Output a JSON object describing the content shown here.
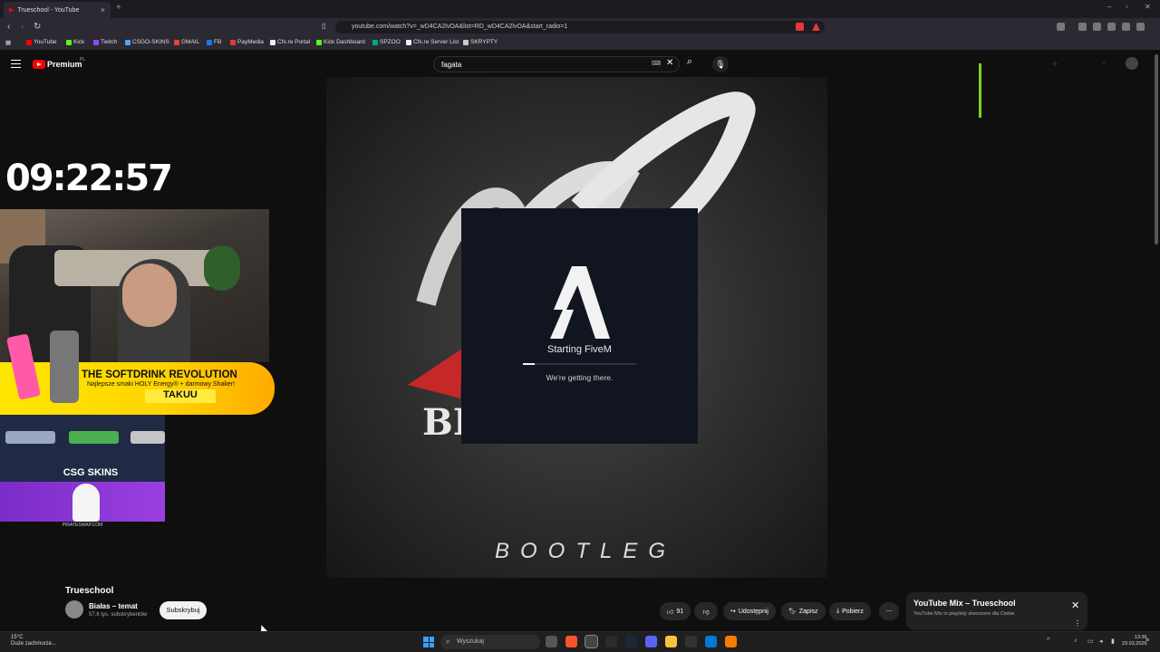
{
  "browser": {
    "tab_title": "Trueschool - YouTube",
    "url": "youtube.com/watch?v=_wD4CA2lvOA&list=RD_wD4CA2lvOA&start_radio=1",
    "bookmarks": [
      "YouTube",
      "Kick",
      "Twitch",
      "CSGO-SKINS",
      "GMAIL",
      "FB",
      "PayMedia",
      "Cfx.re Portal",
      "Kick Dashboard",
      "SPZOO",
      "Cfx.re Server List",
      "SKRYPTY"
    ],
    "bookmark_colors": [
      "#ff0000",
      "#53fc18",
      "#9146ff",
      "#4aa3ff",
      "#ea4335",
      "#1877f2",
      "#e53935",
      "#f0f0f0",
      "#53fc18",
      "#00a884",
      "#f0f0f0",
      "#cccccc"
    ]
  },
  "youtube": {
    "logo_text": "Premium",
    "region": "PL",
    "search_value": "fagata",
    "video_title": "Trueschool",
    "channel_name": "Białas – temat",
    "subscribers": "57,6 tys. subskrybentów",
    "subscribe_label": "Subskrybuj",
    "likes": "91",
    "share_label": "Udostępnij",
    "save_label": "Zapisz",
    "download_label": "Pobierz",
    "mix_title": "YouTube Mix – Trueschool",
    "mix_subtitle": "YouTube Mix to playlisty stworzone dla Ciebie"
  },
  "video_art": {
    "bottom_text": "BOOTLEG",
    "partial_text": "BI"
  },
  "fivem": {
    "title": "Starting FiveM",
    "subtitle": "We're getting there.",
    "progress": 0.1
  },
  "overlay": {
    "clock": "09:22:57",
    "promo_title": "THE SOFTDRINK REVOLUTION",
    "promo_sub": "Najlepsze smaki HOLY Energy® + darmowy Shaker!",
    "promo_code": "TAKUU",
    "csgo_label": "CSG SKINS",
    "pirate_url": "PIRATESWAP.COM"
  },
  "taskbar": {
    "temperature": "15°C",
    "weather": "Duże zachmurze...",
    "search_label": "Wyszukaj",
    "time": "13:36",
    "date": "23.03.2026"
  }
}
